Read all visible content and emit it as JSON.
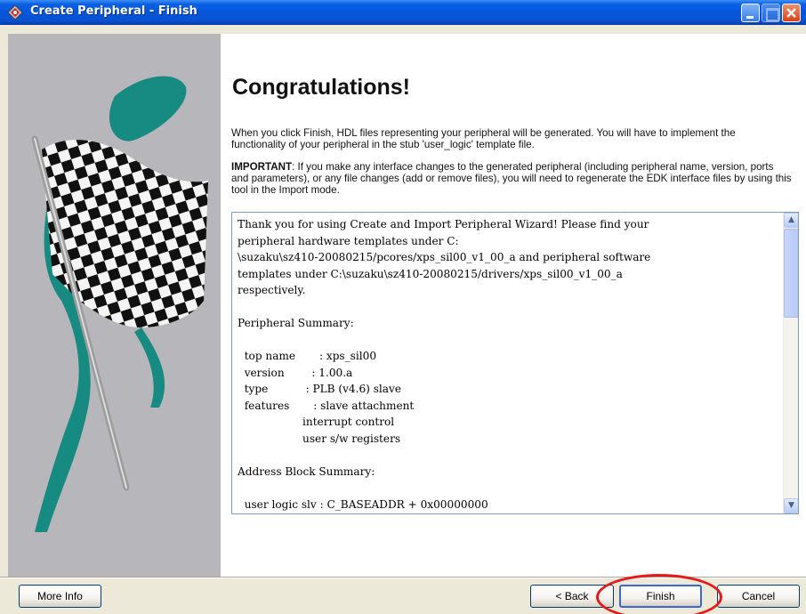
{
  "window": {
    "title": "Create Peripheral - Finish"
  },
  "content": {
    "heading": "Congratulations!",
    "intro": "When you click Finish, HDL files representing your peripheral will be generated. You will have to implement the functionality of your peripheral in the stub 'user_logic' template file.",
    "important_label": "IMPORTANT",
    "important_text": ": If you make any interface changes to the generated peripheral (including peripheral name, version, ports and parameters), or any file changes (add or remove files), you will need to regenerate the EDK interface files by using this tool in the Import mode.",
    "summary_text": "Thank you for using Create and Import Peripheral Wizard! Please find your\nperipheral hardware templates under C:\n\\suzaku\\sz410-20080215/pcores/xps_sil00_v1_00_a and peripheral software\ntemplates under C:\\suzaku\\sz410-20080215/drivers/xps_sil00_v1_00_a\nrespectively.\n\nPeripheral Summary:\n\n  top name       : xps_sil00\n  version        : 1.00.a\n  type           : PLB (v4.6) slave\n  features       : slave attachment\n                   interrupt control\n                   user s/w registers\n\nAddress Block Summary:\n\n  user logic slv : C_BASEADDR + 0x00000000"
  },
  "buttons": {
    "more_info": "More Info",
    "back": "< Back",
    "finish": "Finish",
    "cancel": "Cancel"
  },
  "icons": {
    "window_icon": "xilinx-logo-icon",
    "minimize": "minimize-icon",
    "maximize": "maximize-icon",
    "close": "close-icon",
    "scroll_up": "arrow-up-icon",
    "scroll_down": "arrow-down-icon"
  },
  "colors": {
    "titlebar": "#0556d9",
    "highlight_ring": "#e41a1a",
    "side_panel": "#b7b7bb",
    "flag_teal": "#178a82"
  }
}
